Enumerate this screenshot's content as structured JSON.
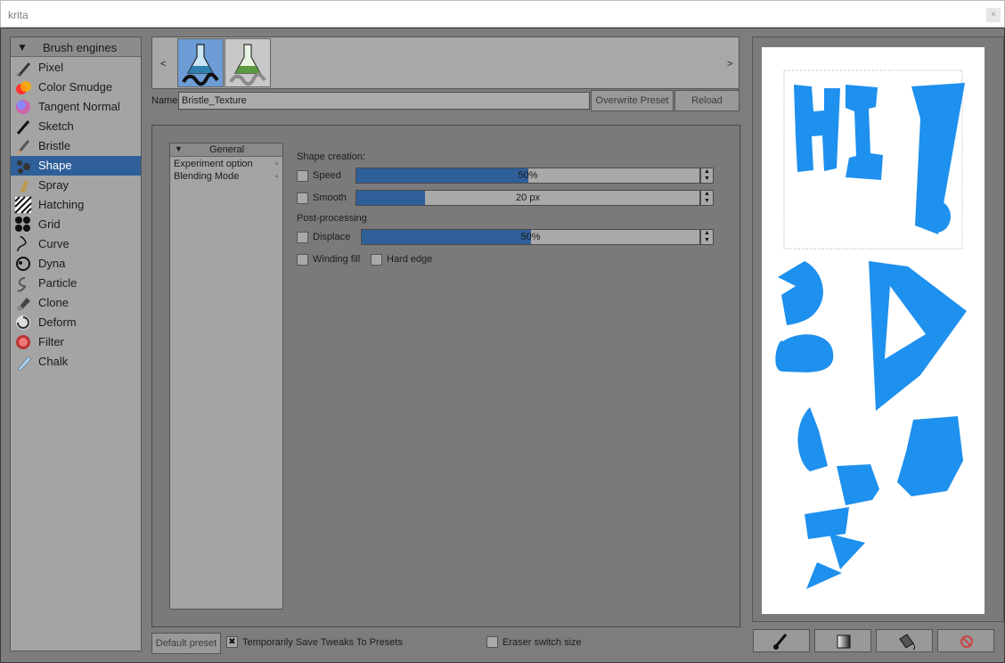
{
  "window": {
    "title": "krita",
    "close_glyph": "×"
  },
  "engines": {
    "header": "Brush engines",
    "items": [
      {
        "label": "Pixel",
        "icon": "pixel-brush-icon"
      },
      {
        "label": "Color Smudge",
        "icon": "color-smudge-icon"
      },
      {
        "label": "Tangent Normal",
        "icon": "tangent-normal-icon"
      },
      {
        "label": "Sketch",
        "icon": "sketch-icon"
      },
      {
        "label": "Bristle",
        "icon": "bristle-icon"
      },
      {
        "label": "Shape",
        "icon": "shape-icon",
        "selected": true
      },
      {
        "label": "Spray",
        "icon": "spray-icon"
      },
      {
        "label": "Hatching",
        "icon": "hatching-icon"
      },
      {
        "label": "Grid",
        "icon": "grid-icon"
      },
      {
        "label": "Curve",
        "icon": "curve-icon"
      },
      {
        "label": "Dyna",
        "icon": "dyna-icon"
      },
      {
        "label": "Particle",
        "icon": "particle-icon"
      },
      {
        "label": "Clone",
        "icon": "clone-icon"
      },
      {
        "label": "Deform",
        "icon": "deform-icon"
      },
      {
        "label": "Filter",
        "icon": "filter-icon"
      },
      {
        "label": "Chalk",
        "icon": "chalk-icon"
      }
    ]
  },
  "presets": {
    "prev": "<",
    "next": ">"
  },
  "name_row": {
    "label": "Name:",
    "value": "Bristle_Texture",
    "overwrite": "Overwrite Preset",
    "reload": "Reload"
  },
  "options_tree": {
    "header": "General",
    "items": [
      "Experiment option",
      "Blending Mode"
    ]
  },
  "shape_settings": {
    "shape_creation": "Shape creation:",
    "speed": {
      "label": "Speed",
      "value": "50%",
      "checked": false,
      "level": 0.5
    },
    "smooth": {
      "label": "Smooth",
      "value": "20 px",
      "checked": false,
      "level": 0.2
    },
    "post_processing": "Post-processing",
    "displace": {
      "label": "Displace",
      "value": "50%",
      "checked": false,
      "level": 0.5
    },
    "winding_fill": {
      "label": "Winding fill",
      "checked": false
    },
    "hard_edge": {
      "label": "Hard edge",
      "checked": false
    }
  },
  "bottom": {
    "default_preset": "Default preset",
    "temp_save": {
      "label": "Temporarily Save Tweaks To Presets",
      "checked": true,
      "glyph": "✖"
    },
    "eraser_switch": {
      "label": "Eraser switch size",
      "checked": false
    }
  },
  "colors": {
    "accent": "#2f5f99",
    "paint": "#1e90ee",
    "panel": "#a4a4a4"
  }
}
